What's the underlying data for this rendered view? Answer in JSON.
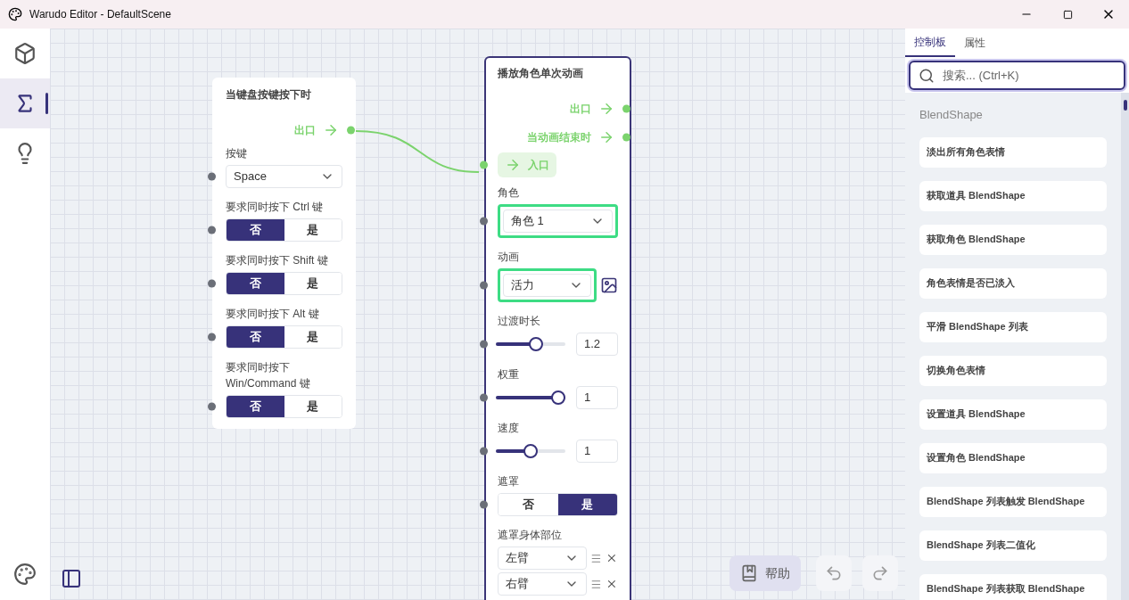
{
  "window": {
    "title": "Warudo Editor - DefaultScene"
  },
  "rail": [
    {
      "kind": "cube",
      "selected": false
    },
    {
      "kind": "sigma",
      "selected": true
    },
    {
      "kind": "bulb",
      "selected": false
    }
  ],
  "nodes": [
    {
      "title": "当键盘按键按下时",
      "outputs": [
        {
          "label": "出口"
        }
      ],
      "fields": [
        {
          "kind": "dropdown",
          "label": "按键",
          "value": "Space",
          "highlighted": false,
          "picker": false
        },
        {
          "kind": "toggle",
          "label": "要求同时按下 Ctrl 键",
          "options": [
            {
              "label": "否",
              "selected": true
            },
            {
              "label": "是",
              "selected": false
            }
          ]
        },
        {
          "kind": "toggle",
          "label": "要求同时按下 Shift 键",
          "options": [
            {
              "label": "否",
              "selected": true
            },
            {
              "label": "是",
              "selected": false
            }
          ]
        },
        {
          "kind": "toggle",
          "label": "要求同时按下 Alt 键",
          "options": [
            {
              "label": "否",
              "selected": true
            },
            {
              "label": "是",
              "selected": false
            }
          ]
        },
        {
          "kind": "toggle",
          "label": "要求同时按下 Win/Command 键",
          "options": [
            {
              "label": "否",
              "selected": true
            },
            {
              "label": "是",
              "selected": false
            }
          ]
        }
      ]
    },
    {
      "title": "播放角色单次动画",
      "outputs": [
        {
          "label": "出口"
        },
        {
          "label": "当动画结束时"
        }
      ],
      "entry": "入口",
      "fields": [
        {
          "kind": "dropdown",
          "label": "角色",
          "value": "角色 1",
          "highlighted": true,
          "picker": false
        },
        {
          "kind": "dropdown",
          "label": "动画",
          "value": "活力",
          "highlighted": true,
          "picker": true
        },
        {
          "kind": "slider",
          "label": "过渡时长",
          "level": 0.6,
          "value": "1.2"
        },
        {
          "kind": "slider",
          "label": "权重",
          "level": 1,
          "value": "1"
        },
        {
          "kind": "slider",
          "label": "速度",
          "level": 0.5,
          "value": "1"
        },
        {
          "kind": "toggle",
          "label": "遮罩",
          "options": [
            {
              "label": "否",
              "selected": false
            },
            {
              "label": "是",
              "selected": true
            }
          ]
        },
        {
          "kind": "list",
          "label": "遮罩身体部位",
          "items": [
            {
              "value": "左臂"
            },
            {
              "value": "右臂"
            }
          ]
        }
      ]
    }
  ],
  "panel": {
    "tabs": [
      {
        "label": "控制板",
        "selected": true
      },
      {
        "label": "属性",
        "selected": false
      }
    ],
    "search": {
      "placeholder": "搜索... (Ctrl+K)"
    },
    "section": "BlendShape",
    "items": [
      "淡出所有角色表情",
      "获取道具 BlendShape",
      "获取角色 BlendShape",
      "角色表情是否已淡入",
      "平滑 BlendShape 列表",
      "切换角色表情",
      "设置道具 BlendShape",
      "设置角色 BlendShape",
      "BlendShape 列表触发 BlendShape",
      "BlendShape 列表二值化",
      "BlendShape 列表获取 BlendShape"
    ]
  },
  "help": {
    "label": "帮助"
  }
}
